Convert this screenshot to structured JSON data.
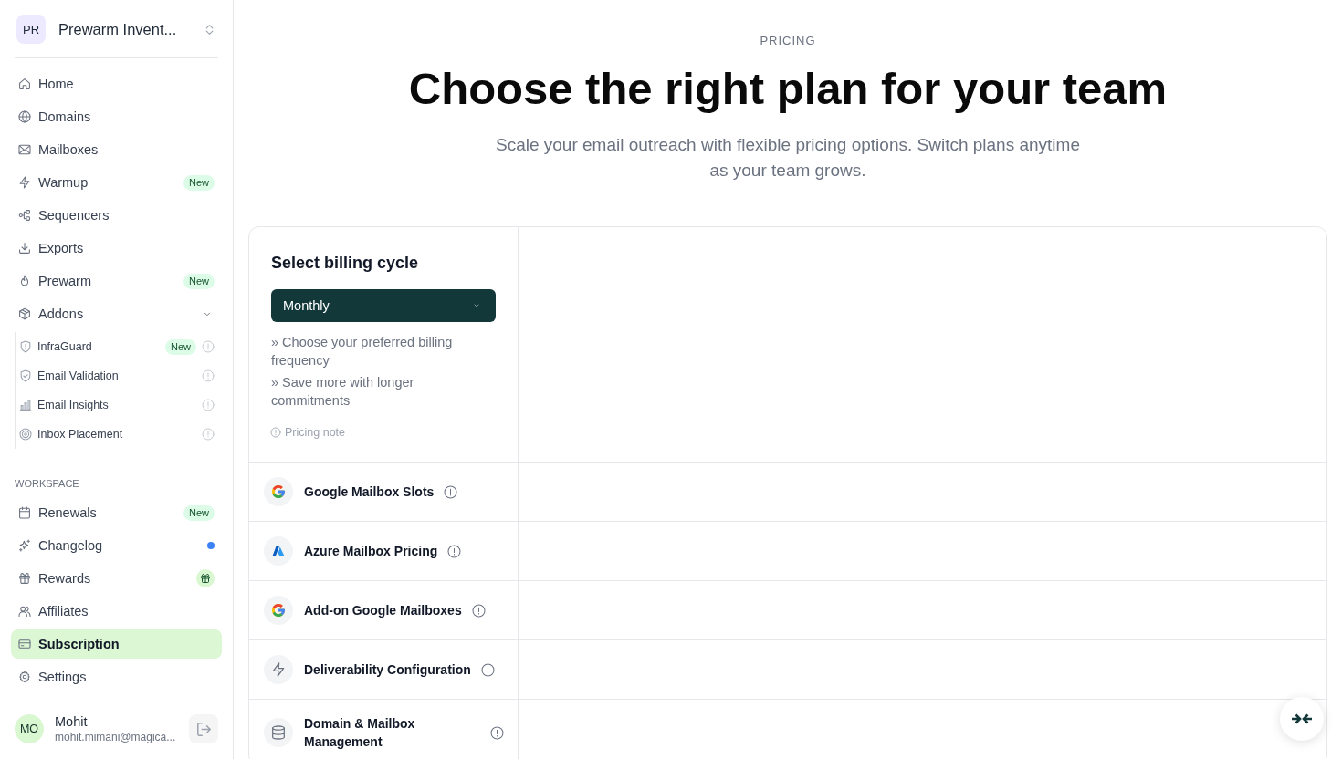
{
  "sidebar": {
    "workspace": {
      "initials": "PR",
      "name": "Prewarm Invent..."
    },
    "nav": [
      {
        "label": "Home",
        "kind": "link",
        "selected": false
      },
      {
        "label": "Domains",
        "kind": "link",
        "selected": false
      },
      {
        "label": "Mailboxes",
        "kind": "link",
        "selected": false
      },
      {
        "label": "Warmup",
        "kind": "badge",
        "badge": "New",
        "selected": false
      },
      {
        "label": "Sequencers",
        "kind": "link",
        "selected": false
      },
      {
        "label": "Exports",
        "kind": "link",
        "selected": false
      },
      {
        "label": "Prewarm",
        "kind": "badge",
        "badge": "New",
        "selected": false
      },
      {
        "label": "Addons",
        "kind": "group",
        "expanded": true,
        "selected": false,
        "children": [
          {
            "label": "InfraGuard",
            "kind": "badge",
            "badge": "New",
            "selected": false
          },
          {
            "label": "Email Validation",
            "kind": "link",
            "selected": false
          },
          {
            "label": "Email Insights",
            "kind": "link",
            "selected": false
          },
          {
            "label": "Inbox Placement",
            "kind": "link",
            "selected": false
          }
        ]
      }
    ],
    "section_label": "WORKSPACE",
    "workspace_nav": [
      {
        "label": "Renewals",
        "kind": "badge",
        "badge": "New",
        "selected": false
      },
      {
        "label": "Changelog",
        "kind": "dot",
        "selected": false
      },
      {
        "label": "Rewards",
        "kind": "gift",
        "selected": false
      },
      {
        "label": "Affiliates",
        "kind": "link",
        "selected": false
      },
      {
        "label": "Subscription",
        "kind": "link",
        "selected": true
      },
      {
        "label": "Settings",
        "kind": "link",
        "selected": false
      }
    ],
    "user": {
      "initials": "MO",
      "name": "Mohit",
      "email": "mohit.mimani@magica..."
    }
  },
  "main": {
    "eyebrow": "PRICING",
    "title": "Choose the right plan for your team",
    "subtitle": "Scale your email outreach with flexible pricing options. Switch plans anytime as your team grows.",
    "billing": {
      "title": "Select billing cycle",
      "dropdown": {
        "value": "Monthly"
      },
      "notes": [
        "» Choose your preferred billing frequency",
        "» Save more with longer commitments"
      ],
      "pricing_note": "Pricing note"
    },
    "features": [
      {
        "label": "Google Mailbox Slots"
      },
      {
        "label": "Azure Mailbox Pricing"
      },
      {
        "label": "Add-on Google Mailboxes"
      },
      {
        "label": "Deliverability Configuration"
      },
      {
        "label": "Domain & Mailbox Management"
      }
    ]
  }
}
